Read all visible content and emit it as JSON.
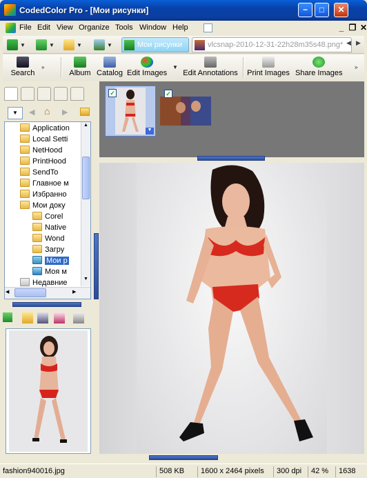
{
  "window": {
    "title": "CodedColor Pro - [Мои рисунки]",
    "controls": {
      "minimize": "−",
      "maximize": "□",
      "close": "✕"
    }
  },
  "menubar": {
    "items": [
      "File",
      "Edit",
      "View",
      "Organize",
      "Tools",
      "Window",
      "Help"
    ],
    "mdi_minimize": "_",
    "mdi_restore": "❐",
    "mdi_close": "✕"
  },
  "navbar": {
    "tabs": [
      {
        "label": "Мои рисунки",
        "active": true
      },
      {
        "label": "vlcsnap-2010-12-31-22h28m35s48.png*",
        "active": false
      }
    ]
  },
  "toolbar": {
    "search": "Search",
    "album": "Album",
    "catalog": "Catalog",
    "edit_images": "Edit Images",
    "edit_annotations": "Edit Annotations",
    "print_images": "Print Images",
    "share_images": "Share Images"
  },
  "tree": {
    "items": [
      "Application",
      "Local Setti",
      "NetHood",
      "PrintHood",
      "SendTo",
      "Главное м",
      "Избранно",
      "Мои доку",
      "Corel",
      "Native",
      "Wond",
      "Загру",
      "Мои р",
      "Моя м",
      "Недавние"
    ],
    "selected_index": 12
  },
  "status": {
    "filename": "fashion940016.jpg",
    "filesize": "508 KB",
    "dimensions": "1600 x 2464 pixels",
    "dpi": "300 dpi",
    "zoom": "42 %",
    "extra": "1638"
  },
  "colors": {
    "title_gradient_top": "#0a5fd8",
    "selection": "#316ac5",
    "thumb_bg": "#777777"
  }
}
